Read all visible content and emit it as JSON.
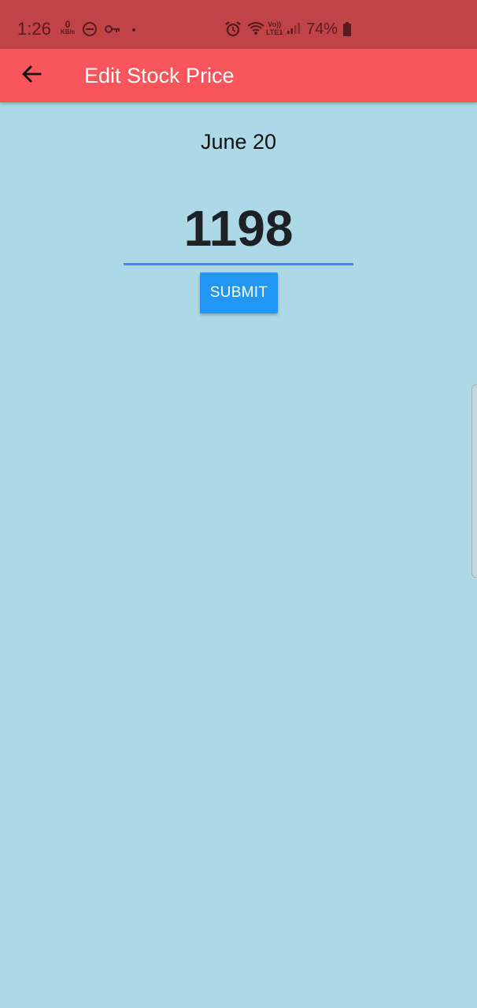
{
  "status_bar": {
    "time": "1:26",
    "data_rate_value": "0",
    "data_rate_unit": "KB/s",
    "network_label_top": "Vo))",
    "network_label_bottom": "LTE1",
    "battery_percent": "74%",
    "icons": [
      "dnd-icon",
      "key-icon",
      "dot-icon",
      "alarm-icon",
      "wifi-icon",
      "signal-icon",
      "battery-icon"
    ]
  },
  "app_bar": {
    "title": "Edit Stock Price",
    "back_icon": "arrow-left-icon"
  },
  "content": {
    "date": "June 20",
    "price_value": "1198",
    "submit_label": "SUBMIT"
  },
  "colors": {
    "status_bar": "#c04348",
    "app_bar": "#f9555b",
    "background": "#add8e6",
    "input_underline": "#4a86e8",
    "submit_button": "#2196f3"
  }
}
